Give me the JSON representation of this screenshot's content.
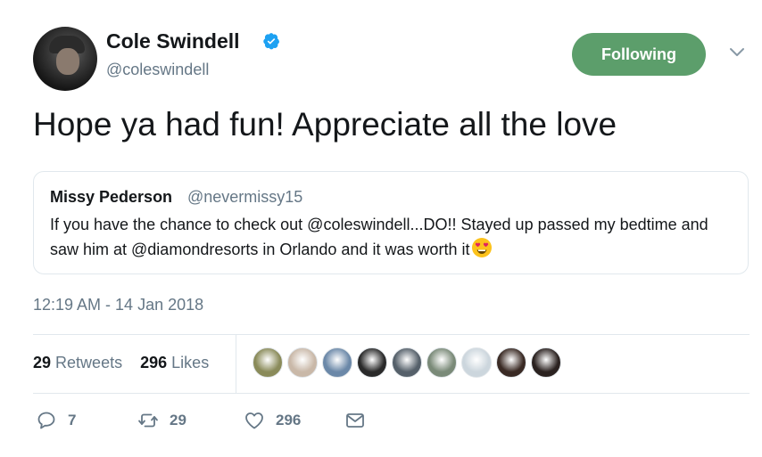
{
  "author": {
    "name": "Cole Swindell",
    "handle": "@coleswindell",
    "verified": true
  },
  "follow_button": {
    "label": "Following",
    "color": "#5c9e6b"
  },
  "tweet": {
    "text": "Hope ya had fun! Appreciate all the love",
    "timestamp": "12:19 AM - 14 Jan 2018"
  },
  "quoted": {
    "name": "Missy Pederson",
    "handle": "@nevermissy15",
    "text": "If you have the chance to check out @coleswindell...DO!! Stayed up passed my bedtime and saw him at @diamondresorts in Orlando and it was worth it",
    "emoji": "heart-eyes-icon"
  },
  "stats": {
    "retweets_count": "29",
    "retweets_label": "Retweets",
    "likes_count": "296",
    "likes_label": "Likes"
  },
  "likers": [
    {
      "bg": "#8a8b5a"
    },
    {
      "bg": "#c9b8a8"
    },
    {
      "bg": "#6b88a8"
    },
    {
      "bg": "#2a2a2a"
    },
    {
      "bg": "#55606a"
    },
    {
      "bg": "#7a8a78"
    },
    {
      "bg": "#ccd6dd"
    },
    {
      "bg": "#3a2a24"
    },
    {
      "bg": "#2b2220"
    }
  ],
  "actions": {
    "reply_count": "7",
    "retweet_count": "29",
    "like_count": "296"
  },
  "colors": {
    "text": "#14171a",
    "secondary": "#657786",
    "verified": "#1da1f2",
    "border": "#e1e8ed"
  }
}
